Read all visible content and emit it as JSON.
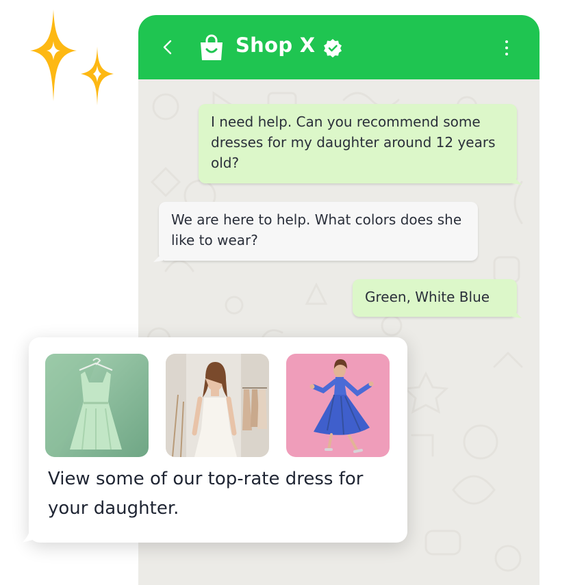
{
  "header": {
    "title": "Shop X",
    "back_icon": "chevron-left-icon",
    "brand_icon": "shopping-bag-icon",
    "verified_icon": "verified-badge-icon",
    "menu_icon": "more-vertical-icon"
  },
  "messages": [
    {
      "direction": "outgoing",
      "text": "I need help. Can you recommend some dresses for my daughter around 12 years old?"
    },
    {
      "direction": "incoming",
      "text": "We are here to help. What colors does she like to wear?"
    },
    {
      "direction": "outgoing",
      "text": "Green, White Blue"
    }
  ],
  "product_card": {
    "text": "View some of our top-rate dress for your daughter."
  },
  "colors": {
    "accent": "#1fc551",
    "outgoing_bubble": "#dcf7c9",
    "incoming_bubble": "#f7f7f7",
    "sparkle": "#fdb813",
    "chat_background": "#ecebe7"
  }
}
